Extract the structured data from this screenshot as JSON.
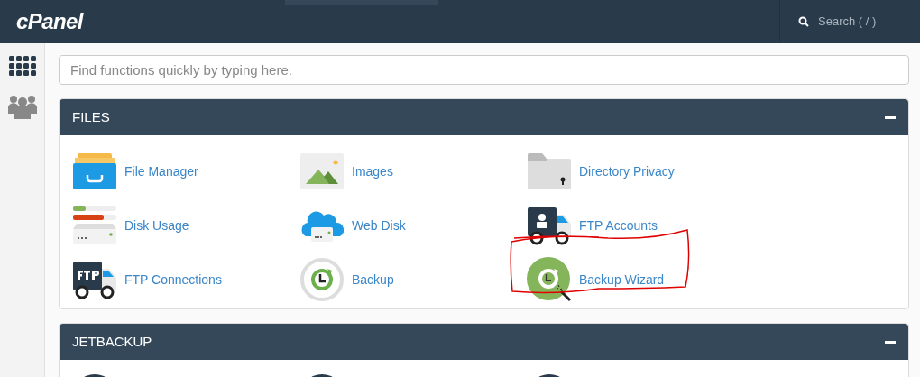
{
  "header": {
    "logo": "cPanel",
    "search_placeholder": "Search ( / )"
  },
  "sidebar": {
    "items": [
      {
        "kind": "grid",
        "selected": false
      },
      {
        "kind": "users",
        "selected": false
      }
    ]
  },
  "search": {
    "placeholder": "Find functions quickly by typing here."
  },
  "panels": [
    {
      "title": "FILES",
      "expanded": true,
      "items": [
        {
          "label": "File Manager",
          "kind": "file-manager",
          "annotated": false
        },
        {
          "label": "Images",
          "kind": "images",
          "annotated": false
        },
        {
          "label": "Directory Privacy",
          "kind": "directory-privacy",
          "annotated": false
        },
        {
          "label": "Disk Usage",
          "kind": "disk-usage",
          "annotated": false
        },
        {
          "label": "Web Disk",
          "kind": "web-disk",
          "annotated": false
        },
        {
          "label": "FTP Accounts",
          "kind": "ftp-accounts",
          "annotated": false
        },
        {
          "label": "FTP Connections",
          "kind": "ftp-connections",
          "annotated": false
        },
        {
          "label": "Backup",
          "kind": "backup",
          "annotated": false
        },
        {
          "label": "Backup Wizard",
          "kind": "backup-wizard",
          "annotated": true
        }
      ]
    },
    {
      "title": "JETBACKUP",
      "expanded": true,
      "items": [
        {
          "kind": "dark-circle"
        },
        {
          "kind": "dark-circle"
        },
        {
          "kind": "dark-circle"
        }
      ]
    }
  ]
}
